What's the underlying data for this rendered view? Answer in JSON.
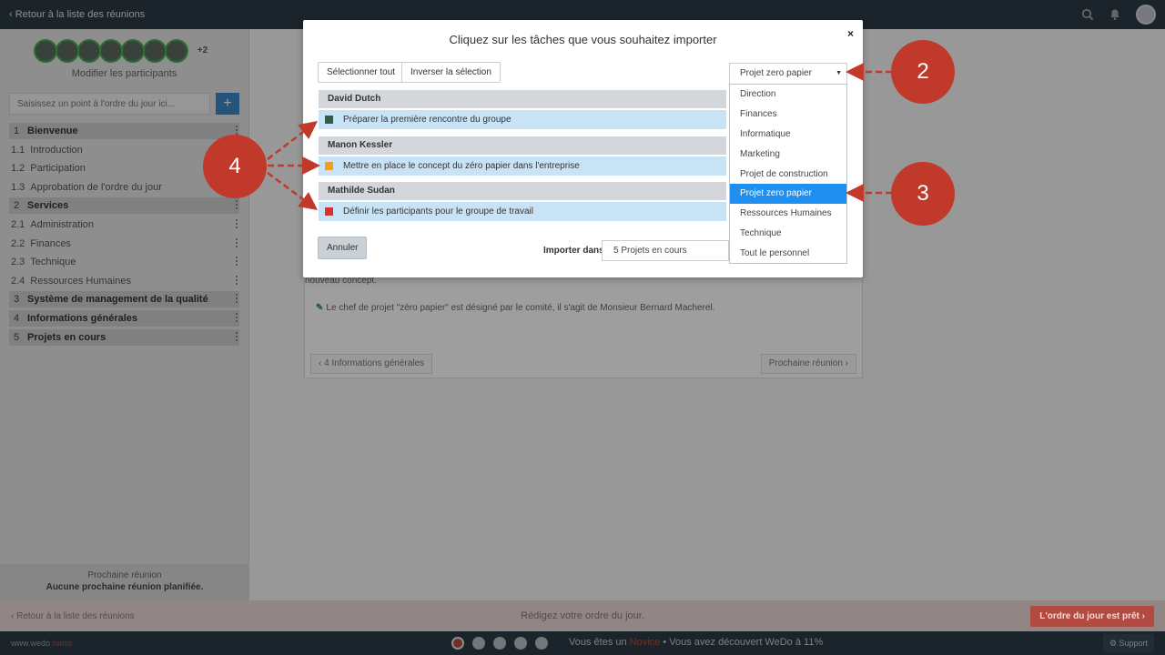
{
  "topbar": {
    "back_label": "Retour à la liste des réunions"
  },
  "sidebar": {
    "more_participants": "+2",
    "modify_participants": "Modifier les participants",
    "agenda_placeholder": "Saisissez un point à l'ordre du jour ici...",
    "add_label": "+",
    "agenda": [
      {
        "num": "1",
        "label": "Bienvenue",
        "type": "section"
      },
      {
        "num": "1.1",
        "label": "Introduction",
        "type": "sub"
      },
      {
        "num": "1.2",
        "label": "Participation",
        "type": "sub"
      },
      {
        "num": "1.3",
        "label": "Approbation de l'ordre du jour",
        "type": "sub"
      },
      {
        "num": "2",
        "label": "Services",
        "type": "section"
      },
      {
        "num": "2.1",
        "label": "Administration",
        "type": "sub"
      },
      {
        "num": "2.2",
        "label": "Finances",
        "type": "sub"
      },
      {
        "num": "2.3",
        "label": "Technique",
        "type": "sub"
      },
      {
        "num": "2.4",
        "label": "Ressources Humaines",
        "type": "sub"
      },
      {
        "num": "3",
        "label": "Système de management de la qualité",
        "type": "section"
      },
      {
        "num": "4",
        "label": "Informations générales",
        "type": "section"
      },
      {
        "num": "5",
        "label": "Projets en cours",
        "type": "section"
      }
    ],
    "next_meeting_title": "Prochaine réunion",
    "next_meeting_value": "Aucune prochaine réunion planifiée."
  },
  "main": {
    "partial_text": "nouveau concept.",
    "note": "Le chef de projet \"zéro papier\" est désigné par le comité, il s'agit de Monsieur Bernard Macherel.",
    "prev_btn": "‹ 4 Informations générales",
    "next_btn": "Prochaine réunion ›"
  },
  "bottom": {
    "back_label": "‹ Retour à la liste des réunions",
    "center_text": "Rédigez votre ordre du jour.",
    "ready_btn": "L'ordre du jour est prêt ›"
  },
  "footer": {
    "brand_main": "www.wedo",
    "brand_accent": ".swiss",
    "msg_pre": "Vous êtes un ",
    "msg_level": "Novice",
    "msg_post": " • Vous avez découvert WeDo à 11%",
    "support": "Support"
  },
  "modal": {
    "title": "Cliquez sur les tâches que vous souhaitez importer",
    "close": "×",
    "select_all": "Sélectionner tout",
    "invert": "Inverser la sélection",
    "project_selected": "Projet zero papier",
    "groups": [
      {
        "person": "David Dutch",
        "task": "Préparer la première rencontre du groupe",
        "color": "#2f5e4a"
      },
      {
        "person": "Manon Kessler",
        "task": "Mettre en place le concept du zéro papier dans l'entreprise",
        "color": "#f0a020"
      },
      {
        "person": "Mathilde Sudan",
        "task": "Définir les participants pour le groupe de travail",
        "color": "#d9332b"
      }
    ],
    "cancel": "Annuler",
    "import_label": "Importer dans:",
    "import_target": "5 Projets en cours"
  },
  "dropdown": {
    "options": [
      "Direction",
      "Finances",
      "Informatique",
      "Marketing",
      "Projet de construction",
      "Projet zero papier",
      "Ressources Humaines",
      "Technique",
      "Tout le personnel"
    ],
    "selected_index": 5
  },
  "callouts": {
    "c2": "2",
    "c3": "3",
    "c4": "4"
  },
  "colors": {
    "accent": "#1e8ff0",
    "callout": "#c0392b",
    "topbar": "#2b3a44"
  }
}
